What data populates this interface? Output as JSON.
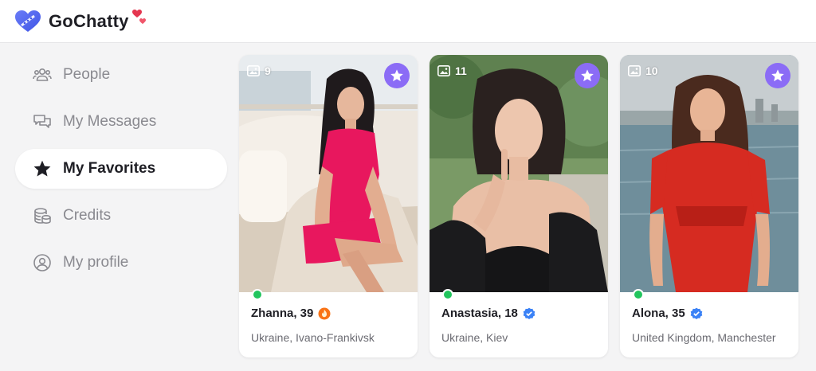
{
  "app": {
    "brand": "GoChatty"
  },
  "sidebar": {
    "items": [
      {
        "label": "People",
        "icon": "people-icon",
        "active": false
      },
      {
        "label": "My Messages",
        "icon": "messages-icon",
        "active": false
      },
      {
        "label": "My Favorites",
        "icon": "star-icon",
        "active": true
      },
      {
        "label": "Credits",
        "icon": "coins-icon",
        "active": false
      },
      {
        "label": "My profile",
        "icon": "profile-icon",
        "active": false
      }
    ]
  },
  "profiles": [
    {
      "name": "Zhanna, 39",
      "location": "Ukraine, Ivano-Frankivsk",
      "photo_count": "9",
      "badge": "fire-icon",
      "online": true
    },
    {
      "name": "Anastasia, 18",
      "location": "Ukraine, Kiev",
      "photo_count": "11",
      "badge": "verified-icon",
      "online": true
    },
    {
      "name": "Alona, 35",
      "location": "United Kingdom, Manchester",
      "photo_count": "10",
      "badge": "verified-icon",
      "online": true
    }
  ],
  "colors": {
    "accent": "#8b6cf6",
    "online": "#22c55e",
    "verified": "#3b82f6",
    "fire": "#f97316",
    "logo": "#5b6cf0"
  }
}
